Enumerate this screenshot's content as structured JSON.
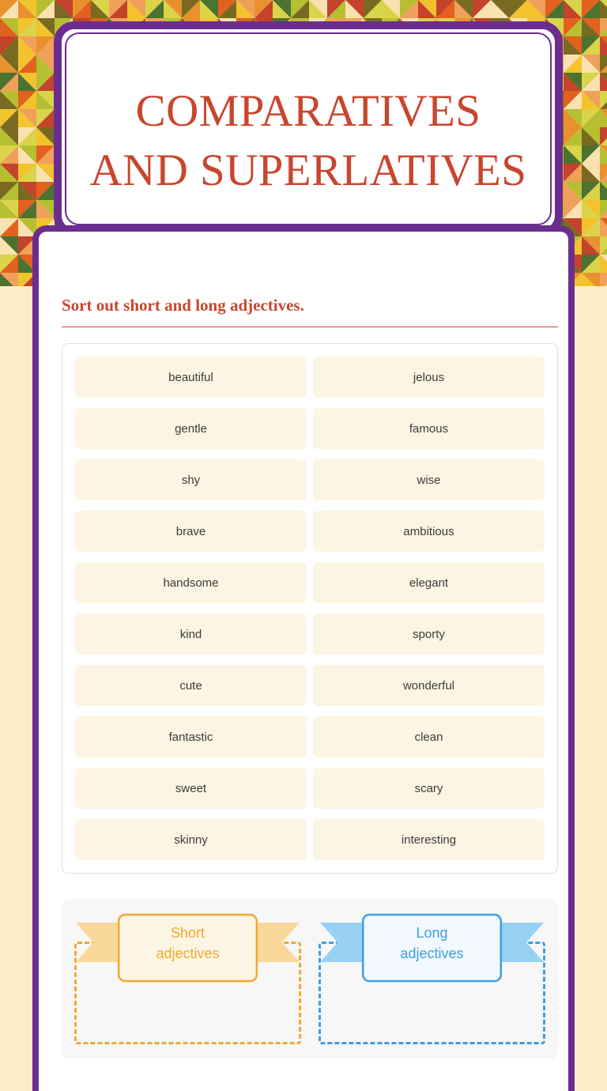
{
  "header": {
    "title": "COMPARATIVES AND SUPERLATIVES",
    "title_line1": "COMPARATIVES",
    "title_line2": "AND SUPERLATIVES",
    "title_color": "#c8462e",
    "border_color": "#6b2d8e"
  },
  "main": {
    "instruction": "Sort out short and long adjectives."
  },
  "word_bank": {
    "words": [
      "beautiful",
      "jelous",
      "gentle",
      "famous",
      "shy",
      "wise",
      "brave",
      "ambitious",
      "handsome",
      "elegant",
      "kind",
      "sporty",
      "cute",
      "wonderful",
      "fantastic",
      "clean",
      "sweet",
      "scary",
      "skinny",
      "interesting"
    ],
    "card_color": "#fdf5e3",
    "text_color": "#3b3b3b"
  },
  "dropzones": [
    {
      "id": "short",
      "label": "Short adjectives",
      "label_line1": "Short",
      "label_line2": "adjectives",
      "accent": "#f0a830",
      "tail_fill": "#fad89a",
      "box_fill": "#fdf5e3",
      "items": []
    },
    {
      "id": "long",
      "label": "Long adjectives",
      "label_line1": "Long",
      "label_line2": "adjectives",
      "accent": "#3c9ee6",
      "tail_fill": "#97d2f5",
      "box_fill": "#f2f8fd",
      "items": []
    }
  ],
  "background": {
    "page_color": "#fceecb",
    "pattern_colors": [
      "#fae1b0",
      "#f3c32e",
      "#e8912e",
      "#e2611f",
      "#c4432b",
      "#b6bf32",
      "#4c7230",
      "#7a6a21",
      "#f0a05a",
      "#d9d44a"
    ]
  }
}
